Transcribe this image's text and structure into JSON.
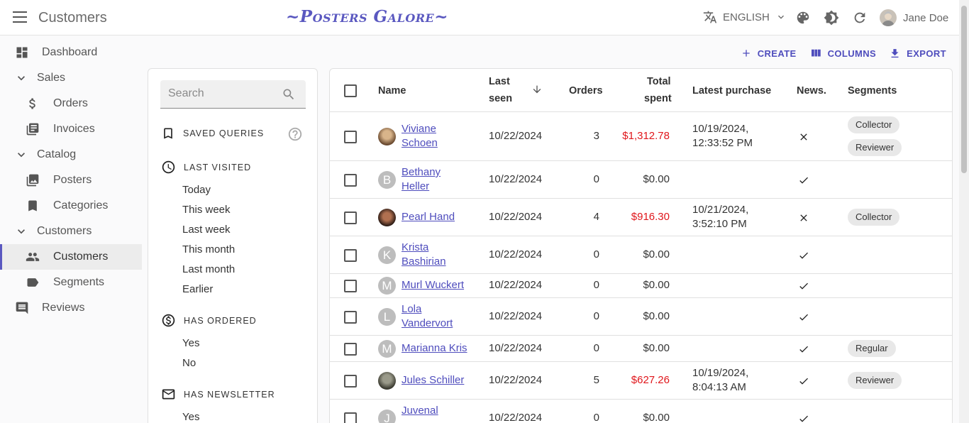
{
  "appbar": {
    "title": "Customers",
    "logo": "~Posters Galore~",
    "language": "ENGLISH",
    "user_name": "Jane Doe"
  },
  "sidebar": {
    "items": [
      {
        "label": "Dashboard",
        "icon": "dashboard-icon",
        "type": "top"
      },
      {
        "label": "Sales",
        "icon": "chevron-down-icon",
        "type": "group"
      },
      {
        "label": "Orders",
        "icon": "dollar-icon",
        "type": "sub"
      },
      {
        "label": "Invoices",
        "icon": "invoices-icon",
        "type": "sub"
      },
      {
        "label": "Catalog",
        "icon": "chevron-down-icon",
        "type": "group"
      },
      {
        "label": "Posters",
        "icon": "image-icon",
        "type": "sub"
      },
      {
        "label": "Categories",
        "icon": "bookmark-icon",
        "type": "sub"
      },
      {
        "label": "Customers",
        "icon": "chevron-down-icon",
        "type": "group"
      },
      {
        "label": "Customers",
        "icon": "people-icon",
        "type": "sub",
        "active": true
      },
      {
        "label": "Segments",
        "icon": "label-icon",
        "type": "sub"
      },
      {
        "label": "Reviews",
        "icon": "comment-icon",
        "type": "top"
      }
    ]
  },
  "actions": {
    "create": "CREATE",
    "columns": "COLUMNS",
    "export": "EXPORT"
  },
  "filters": {
    "search_placeholder": "Search",
    "saved_queries": "SAVED QUERIES",
    "last_visited": {
      "title": "LAST VISITED",
      "options": [
        "Today",
        "This week",
        "Last week",
        "This month",
        "Last month",
        "Earlier"
      ]
    },
    "has_ordered": {
      "title": "HAS ORDERED",
      "options": [
        "Yes",
        "No"
      ]
    },
    "has_newsletter": {
      "title": "HAS NEWSLETTER",
      "options": [
        "Yes"
      ]
    }
  },
  "table": {
    "headers": {
      "name": "Name",
      "last_seen_1": "Last",
      "last_seen_2": "seen",
      "orders": "Orders",
      "total_1": "Total",
      "total_2": "spent",
      "latest_purchase": "Latest purchase",
      "news": "News.",
      "segments": "Segments"
    },
    "rows": [
      {
        "name1": "Viviane",
        "name2": "Schoen",
        "avatar": "photo1",
        "last_seen": "10/22/2024",
        "orders": "3",
        "total": "$1,312.78",
        "red": true,
        "lp1": "10/19/2024,",
        "lp2": "12:33:52 PM",
        "news": "cross",
        "segments": [
          "Collector",
          "Reviewer"
        ]
      },
      {
        "name1": "Bethany",
        "name2": "Heller",
        "avatar": "B",
        "last_seen": "10/22/2024",
        "orders": "0",
        "total": "$0.00",
        "red": false,
        "lp1": "",
        "lp2": "",
        "news": "check",
        "segments": []
      },
      {
        "name1": "Pearl Hand",
        "name2": "",
        "avatar": "photo2",
        "last_seen": "10/22/2024",
        "orders": "4",
        "total": "$916.30",
        "red": true,
        "lp1": "10/21/2024,",
        "lp2": "3:52:10 PM",
        "news": "cross",
        "segments": [
          "Collector"
        ]
      },
      {
        "name1": "Krista",
        "name2": "Bashirian",
        "avatar": "K",
        "last_seen": "10/22/2024",
        "orders": "0",
        "total": "$0.00",
        "red": false,
        "lp1": "",
        "lp2": "",
        "news": "check",
        "segments": []
      },
      {
        "name1": "Murl Wuckert",
        "name2": "",
        "avatar": "M",
        "last_seen": "10/22/2024",
        "orders": "0",
        "total": "$0.00",
        "red": false,
        "lp1": "",
        "lp2": "",
        "news": "check",
        "segments": []
      },
      {
        "name1": "Lola",
        "name2": "Vandervort",
        "avatar": "L",
        "last_seen": "10/22/2024",
        "orders": "0",
        "total": "$0.00",
        "red": false,
        "lp1": "",
        "lp2": "",
        "news": "check",
        "segments": []
      },
      {
        "name1": "Marianna Kris",
        "name2": "",
        "avatar": "M",
        "last_seen": "10/22/2024",
        "orders": "0",
        "total": "$0.00",
        "red": false,
        "lp1": "",
        "lp2": "",
        "news": "check",
        "segments": [
          "Regular"
        ]
      },
      {
        "name1": "Jules Schiller",
        "name2": "",
        "avatar": "photo3",
        "last_seen": "10/22/2024",
        "orders": "5",
        "total": "$627.26",
        "red": true,
        "lp1": "10/19/2024,",
        "lp2": "8:04:13 AM",
        "news": "check",
        "segments": [
          "Reviewer"
        ]
      },
      {
        "name1": "Juvenal",
        "name2": "",
        "avatar": "J",
        "last_seen": "10/22/2024",
        "orders": "0",
        "total": "$0.00",
        "red": false,
        "lp1": "",
        "lp2": "",
        "news": "check",
        "segments": []
      }
    ]
  },
  "colors": {
    "accent": "#4f4dbd",
    "logo": "#5a58c0",
    "negative": "#e0161b"
  }
}
